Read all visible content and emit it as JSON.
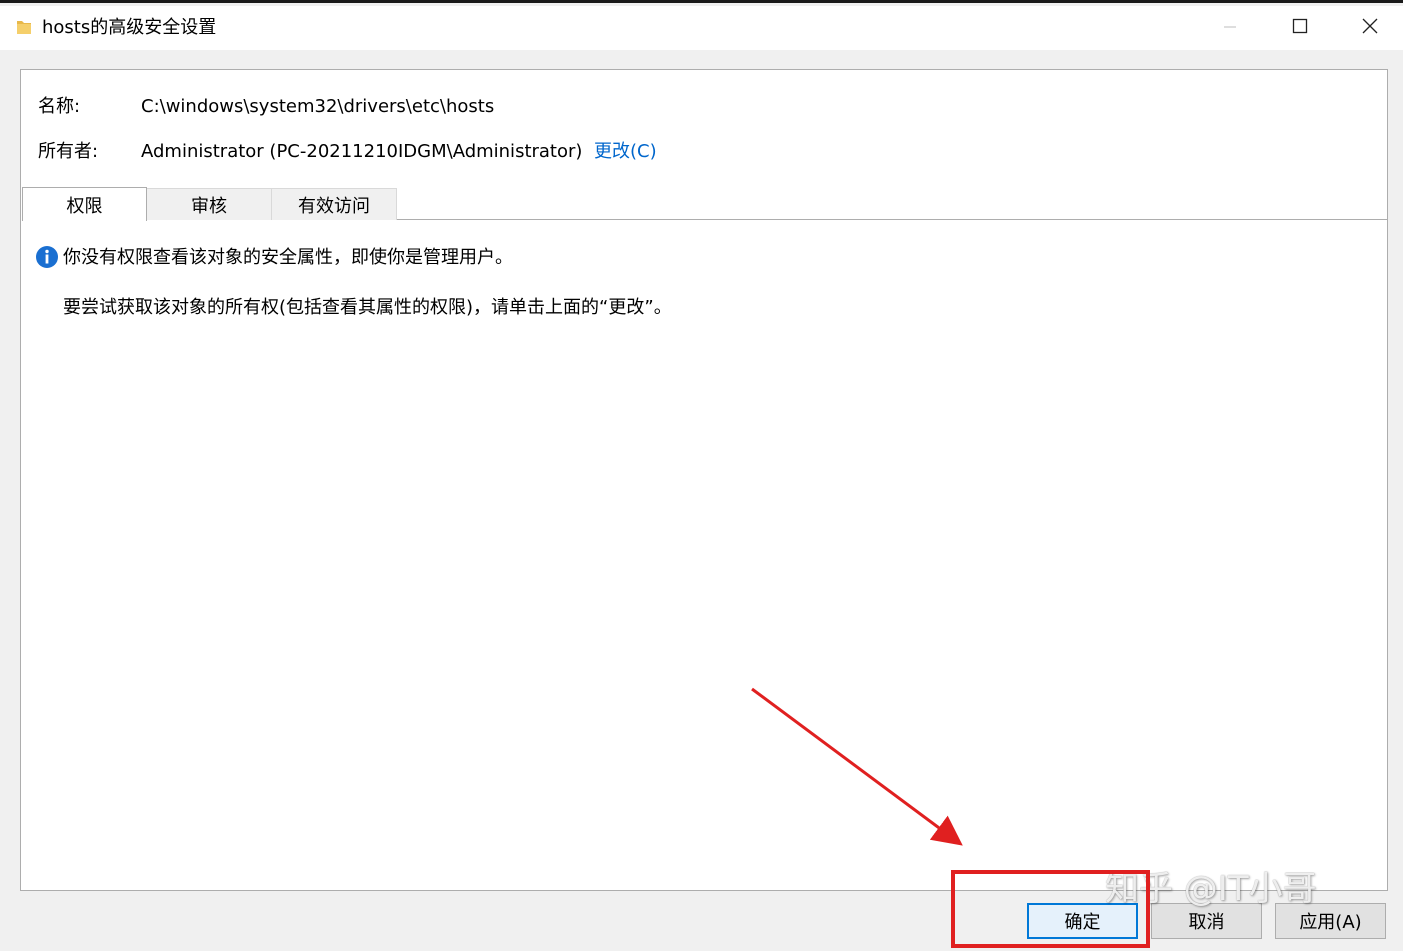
{
  "window": {
    "title": "hosts的高级安全设置",
    "folder_icon": "folder-icon",
    "minimize_icon": "minimize-icon",
    "maximize_icon": "maximize-icon",
    "close_icon": "close-icon"
  },
  "properties": {
    "name_label": "名称:",
    "name_value": "C:\\windows\\system32\\drivers\\etc\\hosts",
    "owner_label": "所有者:",
    "owner_value": "Administrator (PC-20211210IDGM\\Administrator)",
    "change_link": "更改(C)"
  },
  "tabs": [
    {
      "label": "权限",
      "active": true
    },
    {
      "label": "审核",
      "active": false
    },
    {
      "label": "有效访问",
      "active": false
    }
  ],
  "message": {
    "icon": "info-icon",
    "line1": "你没有权限查看该对象的安全属性，即使你是管理用户。",
    "line2": "要尝试获取该对象的所有权(包括查看其属性的权限)，请单击上面的“更改”。"
  },
  "buttons": {
    "ok": "确定",
    "cancel": "取消",
    "apply": "应用(A)"
  },
  "watermark": "知乎 @IT小哥",
  "colors": {
    "link": "#0066cc",
    "info": "#1a6fd1",
    "annotation": "#e02020",
    "focus": "#0078d7"
  }
}
